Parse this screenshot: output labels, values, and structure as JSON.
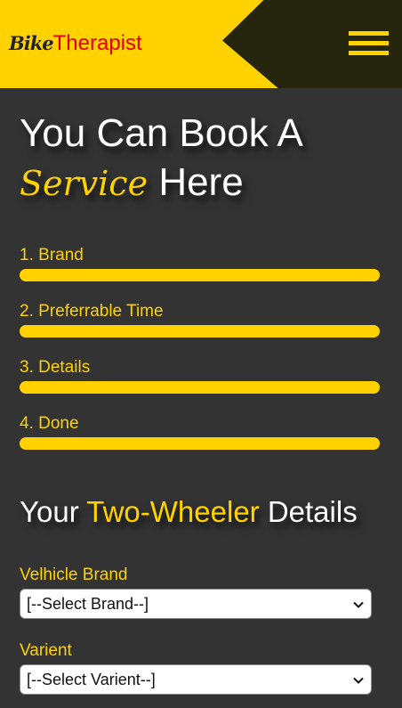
{
  "header": {
    "logo_part1": "Bike",
    "logo_part2": "Therapist",
    "menu_icon": "hamburger-menu-icon"
  },
  "hero": {
    "line1": "You Can Book A",
    "script_word": "Service",
    "line2_rest": "Here"
  },
  "steps": [
    {
      "label": "1. Brand"
    },
    {
      "label": "2. Preferrable Time"
    },
    {
      "label": "3. Details"
    },
    {
      "label": "4. Done"
    }
  ],
  "section": {
    "part1": "Your",
    "accent": "Two-Wheeler",
    "part2": "Details"
  },
  "form": {
    "brand_label": "Velhicle Brand",
    "brand_value": "[--Select Brand--]",
    "variant_label": "Varient",
    "variant_value": "[--Select Varient--]"
  },
  "colors": {
    "accent": "#FFD200",
    "background": "#333333",
    "header_dark": "#26260F",
    "logo_red": "#E00000"
  }
}
